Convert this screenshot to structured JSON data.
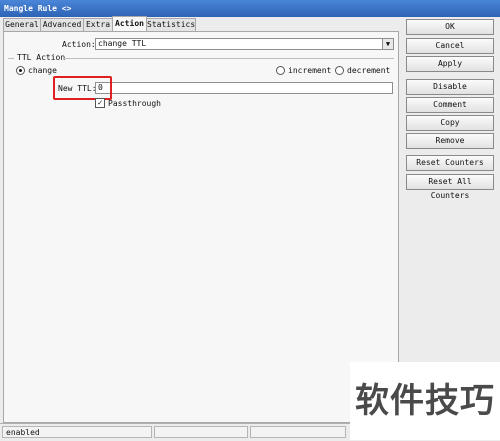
{
  "window": {
    "title": "Mangle Rule <>",
    "close_glyph": "◇"
  },
  "tabs": [
    {
      "label": "General",
      "active": false
    },
    {
      "label": "Advanced",
      "active": false
    },
    {
      "label": "Extra",
      "active": false
    },
    {
      "label": "Action",
      "active": true
    },
    {
      "label": "Statistics",
      "active": false
    }
  ],
  "action": {
    "label": "Action:",
    "value": "change TTL",
    "dropdown_icon": "triangle-down-icon"
  },
  "ttl_action": {
    "group_label": "TTL Action",
    "options": [
      {
        "label": "change",
        "selected": true
      },
      {
        "label": "increment",
        "selected": false
      },
      {
        "label": "decrement",
        "selected": false
      }
    ],
    "new_ttl_label": "New TTL:",
    "new_ttl_value": "0"
  },
  "passthrough": {
    "label": "Passthrough",
    "checked": true
  },
  "buttons": {
    "ok": "OK",
    "cancel": "Cancel",
    "apply": "Apply",
    "disable": "Disable",
    "comment": "Comment",
    "copy": "Copy",
    "remove": "Remove",
    "reset_counters": "Reset Counters",
    "reset_all_counters": "Reset All Counters"
  },
  "status": {
    "state": "enabled",
    "cell2": "",
    "cell3": ""
  },
  "watermark": {
    "text": "软件技巧"
  },
  "colors": {
    "titlebar": "#2e62b5",
    "highlight": "#e02020",
    "panel_bg": "#f7f7f7",
    "window_bg": "#ececec"
  }
}
